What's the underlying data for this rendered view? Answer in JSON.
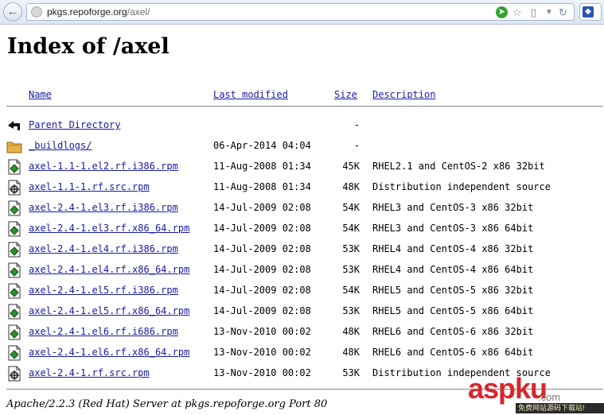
{
  "browser": {
    "url_host": "pkgs.repoforge.org",
    "url_path": "/axel/"
  },
  "page": {
    "title": "Index of /axel",
    "footer": "Apache/2.2.3 (Red Hat) Server at pkgs.repoforge.org Port 80"
  },
  "columns": {
    "name": "Name",
    "modified": "Last modified",
    "size": "Size",
    "description": "Description"
  },
  "rows": [
    {
      "icon": "back-icon",
      "name": "Parent Directory",
      "date": "",
      "size": "-",
      "desc": ""
    },
    {
      "icon": "folder-icon",
      "name": "_buildlogs/",
      "date": "06-Apr-2014 04:04",
      "size": "-",
      "desc": ""
    },
    {
      "icon": "package-icon",
      "name": "axel-1.1-1.el2.rf.i386.rpm",
      "date": "11-Aug-2008 01:34",
      "size": "45K",
      "desc": "RHEL2.1 and CentOS-2 x86 32bit"
    },
    {
      "icon": "source-package-icon",
      "name": "axel-1.1-1.rf.src.rpm",
      "date": "11-Aug-2008 01:34",
      "size": "48K",
      "desc": "Distribution independent source"
    },
    {
      "icon": "package-icon",
      "name": "axel-2.4-1.el3.rf.i386.rpm",
      "date": "14-Jul-2009 02:08",
      "size": "54K",
      "desc": "RHEL3 and CentOS-3 x86 32bit"
    },
    {
      "icon": "package-icon",
      "name": "axel-2.4-1.el3.rf.x86_64.rpm",
      "date": "14-Jul-2009 02:08",
      "size": "54K",
      "desc": "RHEL3 and CentOS-3 x86 64bit"
    },
    {
      "icon": "package-icon",
      "name": "axel-2.4-1.el4.rf.i386.rpm",
      "date": "14-Jul-2009 02:08",
      "size": "53K",
      "desc": "RHEL4 and CentOS-4 x86 32bit"
    },
    {
      "icon": "package-icon",
      "name": "axel-2.4-1.el4.rf.x86_64.rpm",
      "date": "14-Jul-2009 02:08",
      "size": "53K",
      "desc": "RHEL4 and CentOS-4 x86 64bit"
    },
    {
      "icon": "package-icon",
      "name": "axel-2.4-1.el5.rf.i386.rpm",
      "date": "14-Jul-2009 02:08",
      "size": "54K",
      "desc": "RHEL5 and CentOS-5 x86 32bit"
    },
    {
      "icon": "package-icon",
      "name": "axel-2.4-1.el5.rf.x86_64.rpm",
      "date": "14-Jul-2009 02:08",
      "size": "53K",
      "desc": "RHEL5 and CentOS-5 x86 64bit"
    },
    {
      "icon": "package-icon",
      "name": "axel-2.4-1.el6.rf.i686.rpm",
      "date": "13-Nov-2010 00:02",
      "size": "48K",
      "desc": "RHEL6 and CentOS-6 x86 32bit"
    },
    {
      "icon": "package-icon",
      "name": "axel-2.4-1.el6.rf.x86_64.rpm",
      "date": "13-Nov-2010 00:02",
      "size": "48K",
      "desc": "RHEL6 and CentOS-6 x86 64bit"
    },
    {
      "icon": "source-package-icon",
      "name": "axel-2.4-1.rf.src.rpm",
      "date": "13-Nov-2010 00:02",
      "size": "53K",
      "desc": "Distribution independent source"
    }
  ],
  "watermark": {
    "main": "aspku",
    "domain": ".com",
    "tagline": "免费网站源码下载站!"
  },
  "colors": {
    "link": "#1a1aa6",
    "watermark": "#d8262c"
  }
}
